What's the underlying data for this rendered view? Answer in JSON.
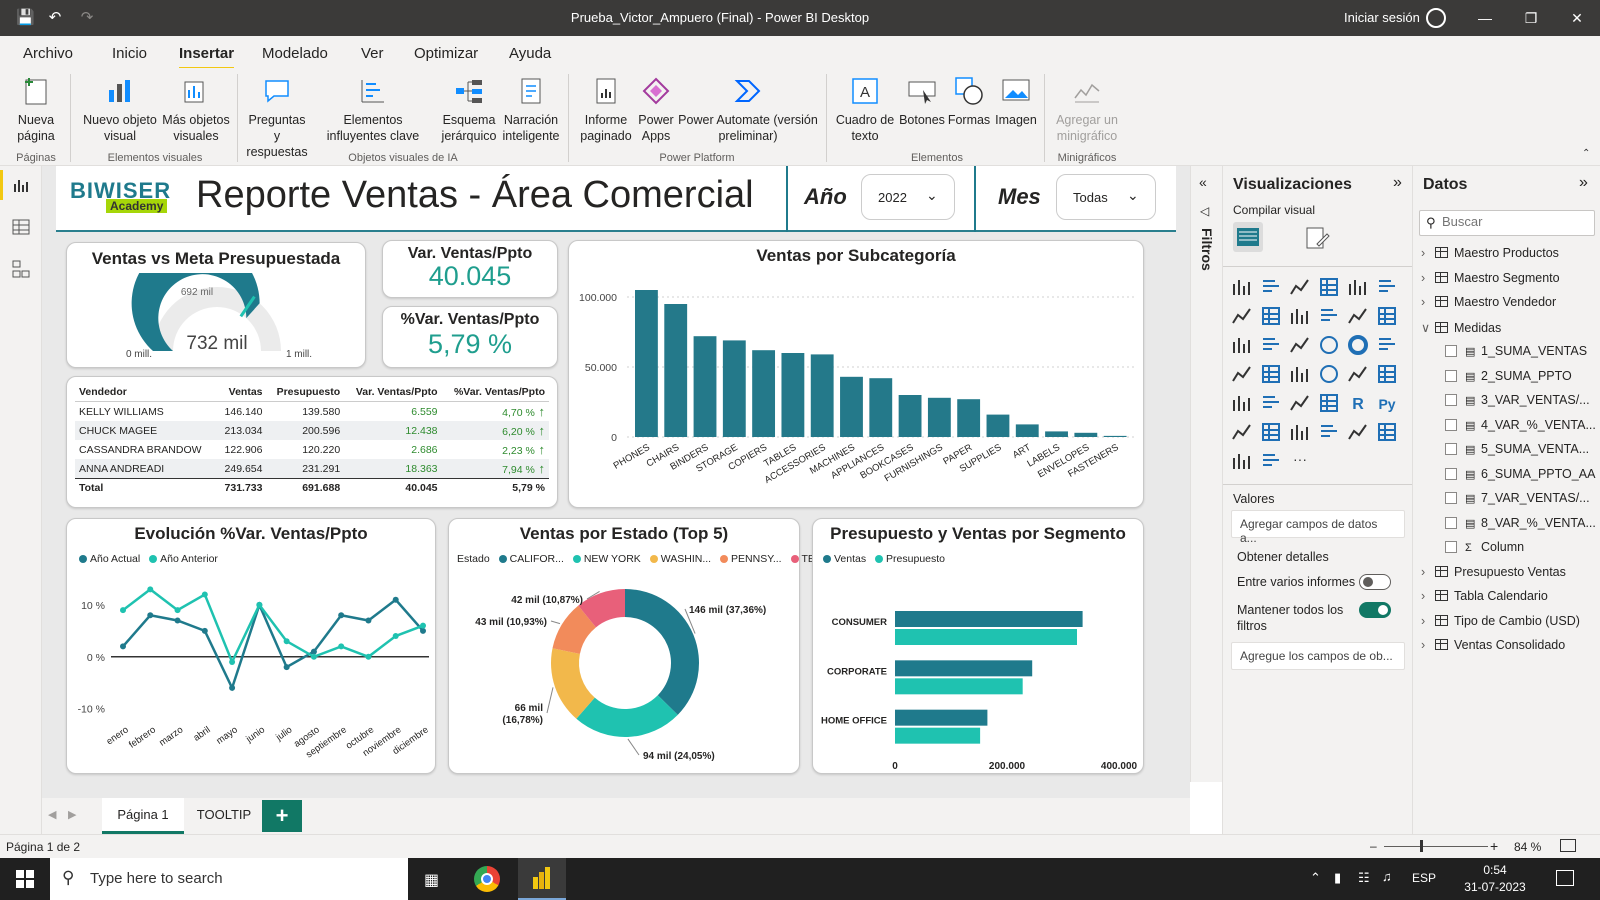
{
  "window": {
    "title": "Prueba_Victor_Ampuero (Final) - Power BI Desktop",
    "signin": "Iniciar sesión"
  },
  "menu": [
    "Archivo",
    "Inicio",
    "Insertar",
    "Modelado",
    "Ver",
    "Optimizar",
    "Ayuda"
  ],
  "ribbon": {
    "nueva_pagina": "Nueva página",
    "nuevo_objeto": "Nuevo objeto visual",
    "mas_objetos": "Más objetos visuales",
    "preguntas": "Preguntas y respuestas",
    "influyentes": "Elementos influyentes clave",
    "esquema": "Esquema jerárquico",
    "narracion": "Narración inteligente",
    "informe": "Informe paginado",
    "power_apps": "Power Apps",
    "power_automate": "Power Automate (versión preliminar)",
    "cuadro_texto": "Cuadro de texto",
    "botones": "Botones",
    "formas": "Formas",
    "imagen": "Imagen",
    "minigrafico": "Agregar un minigráfico",
    "groups": {
      "paginas": "Páginas",
      "elementos_visuales": "Elementos visuales",
      "ia": "Objetos visuales de IA",
      "platform": "Power Platform",
      "elementos": "Elementos",
      "minigraficos": "Minigráficos"
    }
  },
  "report": {
    "logo_top": "BIWISER",
    "logo_bottom": "Academy",
    "title": "Reporte Ventas - Área Comercial",
    "year_label": "Año",
    "year_value": "2022",
    "month_label": "Mes",
    "month_value": "Todas"
  },
  "gauge": {
    "title": "Ventas vs Meta Presupuestada",
    "value": "732 mil",
    "target": "692 mil",
    "min": "0 mill.",
    "max": "1 mill.",
    "fill_fraction": 0.732,
    "target_fraction": 0.692
  },
  "kpi1": {
    "title": "Var. Ventas/Ppto",
    "value": "40.045"
  },
  "kpi2": {
    "title": "%Var. Ventas/Ppto",
    "value": "5,79 %"
  },
  "table": {
    "headers": [
      "Vendedor",
      "Ventas",
      "Presupuesto",
      "Var. Ventas/Ppto",
      "%Var. Ventas/Ppto"
    ],
    "rows": [
      [
        "KELLY WILLIAMS",
        "146.140",
        "139.580",
        "6.559",
        "4,70 %"
      ],
      [
        "CHUCK MAGEE",
        "213.034",
        "200.596",
        "12.438",
        "6,20 %"
      ],
      [
        "CASSANDRA BRANDOW",
        "122.906",
        "120.220",
        "2.686",
        "2,23 %"
      ],
      [
        "ANNA ANDREADI",
        "249.654",
        "231.291",
        "18.363",
        "7,94 %"
      ]
    ],
    "total": [
      "Total",
      "731.733",
      "691.688",
      "40.045",
      "5,79 %"
    ]
  },
  "chart_data": [
    {
      "type": "bar",
      "title": "Ventas por Subcategoría",
      "categories": [
        "PHONES",
        "CHAIRS",
        "BINDERS",
        "STORAGE",
        "COPIERS",
        "TABLES",
        "ACCESSORIES",
        "MACHINES",
        "APPLIANCES",
        "BOOKCASES",
        "FURNISHINGS",
        "PAPER",
        "SUPPLIES",
        "ART",
        "LABELS",
        "ENVELOPES",
        "FASTENERS"
      ],
      "values": [
        105000,
        95000,
        72000,
        69000,
        62000,
        60000,
        59000,
        43000,
        42000,
        30000,
        28000,
        27000,
        16000,
        9000,
        4000,
        3000,
        800
      ],
      "yticks": [
        "0",
        "50.000",
        "100.000"
      ],
      "ylim": [
        0,
        110000
      ],
      "grid": true
    },
    {
      "type": "line",
      "title": "Evolución %Var. Ventas/Ppto",
      "categories": [
        "enero",
        "febrero",
        "marzo",
        "abril",
        "mayo",
        "junio",
        "julio",
        "agosto",
        "septiembre",
        "octubre",
        "noviembre",
        "diciembre"
      ],
      "series": [
        {
          "name": "Año Actual",
          "color": "#1f7a8c",
          "values": [
            2,
            8,
            7,
            5,
            -6,
            10,
            -2,
            1,
            8,
            7,
            11,
            5
          ]
        },
        {
          "name": "Año Anterior",
          "color": "#1fc2b0",
          "values": [
            9,
            13,
            9,
            12,
            -1,
            10,
            3,
            0,
            2,
            0,
            4,
            6
          ]
        }
      ],
      "yticks": [
        "10 %",
        "0 %",
        "-10 %"
      ],
      "ylim": [
        -12,
        15
      ],
      "legend": "top-left"
    },
    {
      "type": "pie",
      "title": "Ventas por Estado (Top 5)",
      "legend_title": "Estado",
      "categories": [
        "CALIFOR...",
        "NEW YORK",
        "WASHIN...",
        "PENNSY...",
        "TEXAS"
      ],
      "values": [
        37.36,
        24.05,
        16.78,
        10.93,
        10.87
      ],
      "labels": [
        "146 mil (37,36%)",
        "94 mil (24,05%)",
        "66 mil (16,78%)",
        "43 mil (10,93%)",
        "42 mil (10,87%)"
      ],
      "colors": [
        "#1f7a8c",
        "#1fc2b0",
        "#f2b84b",
        "#f28b5b",
        "#e8607a"
      ],
      "legend": "top-left"
    },
    {
      "type": "bar",
      "title": "Presupuesto y Ventas por Segmento",
      "orientation": "horizontal",
      "categories": [
        "CONSUMER",
        "CORPORATE",
        "HOME OFFICE"
      ],
      "series": [
        {
          "name": "Ventas",
          "color": "#1f7a8c",
          "values": [
            335000,
            245000,
            165000
          ]
        },
        {
          "name": "Presupuesto",
          "color": "#1fc2b0",
          "values": [
            325000,
            228000,
            152000
          ]
        }
      ],
      "xticks": [
        "0",
        "200.000",
        "400.000"
      ],
      "xlim": [
        0,
        420000
      ],
      "legend": "top-left"
    }
  ],
  "filters_label": "Filtros",
  "viz": {
    "title": "Visualizaciones",
    "compile": "Compilar visual",
    "valores": "Valores",
    "add_fields": "Agregar campos de datos a...",
    "details": "Obtener detalles",
    "cross": "Entre varios informes",
    "keep": "Mantener todos los filtros",
    "detail_fields": "Agregue los campos de ob..."
  },
  "data": {
    "title": "Datos",
    "search_placeholder": "Buscar",
    "tables": [
      "Maestro Productos",
      "Maestro Segmento",
      "Maestro Vendedor",
      "Medidas"
    ],
    "measures": [
      "1_SUMA_VENTAS",
      "2_SUMA_PPTO",
      "3_VAR_VENTAS/...",
      "4_VAR_%_VENTA...",
      "5_SUMA_VENTA...",
      "6_SUMA_PPTO_AA",
      "7_VAR_VENTAS/...",
      "8_VAR_%_VENTA...",
      "Column"
    ],
    "tables2": [
      "Presupuesto Ventas",
      "Tabla Calendario",
      "Tipo de Cambio (USD)",
      "Ventas Consolidado"
    ]
  },
  "tabs": [
    "Página 1",
    "TOOLTIP"
  ],
  "status": {
    "page": "Página 1 de 2",
    "zoom": "84 %"
  },
  "taskbar": {
    "search": "Type here to search",
    "lang": "ESP",
    "time": "0:54",
    "date": "31-07-2023"
  }
}
